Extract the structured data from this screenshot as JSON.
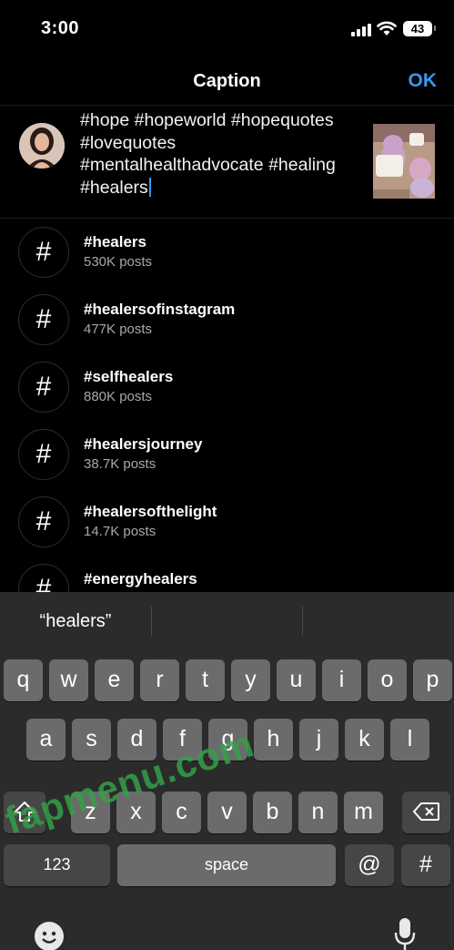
{
  "status_bar": {
    "time": "3:00",
    "battery": "43"
  },
  "header": {
    "title": "Caption",
    "ok_label": "OK"
  },
  "caption": {
    "text": "#hope #hopeworld #hopequotes #lovequotes #mentalhealthadvocate #healing #healers"
  },
  "suggestions": [
    {
      "tag": "#healers",
      "count": "530K posts"
    },
    {
      "tag": "#healersofinstagram",
      "count": "477K posts"
    },
    {
      "tag": "#selfhealers",
      "count": "880K posts"
    },
    {
      "tag": "#healersjourney",
      "count": "38.7K posts"
    },
    {
      "tag": "#healersofthelight",
      "count": "14.7K posts"
    },
    {
      "tag": "#energyhealers",
      "count": ""
    }
  ],
  "hash_symbol": "#",
  "keyboard": {
    "prediction": "“healers”",
    "row1": [
      "q",
      "w",
      "e",
      "r",
      "t",
      "y",
      "u",
      "i",
      "o",
      "p"
    ],
    "row2": [
      "a",
      "s",
      "d",
      "f",
      "g",
      "h",
      "j",
      "k",
      "l"
    ],
    "row3": [
      "z",
      "x",
      "c",
      "v",
      "b",
      "n",
      "m"
    ],
    "numbers_label": "123",
    "space_label": "space",
    "at_label": "@",
    "hash_label": "#"
  },
  "watermark": {
    "text": "fapmenu.com"
  },
  "colors": {
    "accent": "#3797f0",
    "background": "#000000",
    "keyboard": "#2b2b2b"
  }
}
